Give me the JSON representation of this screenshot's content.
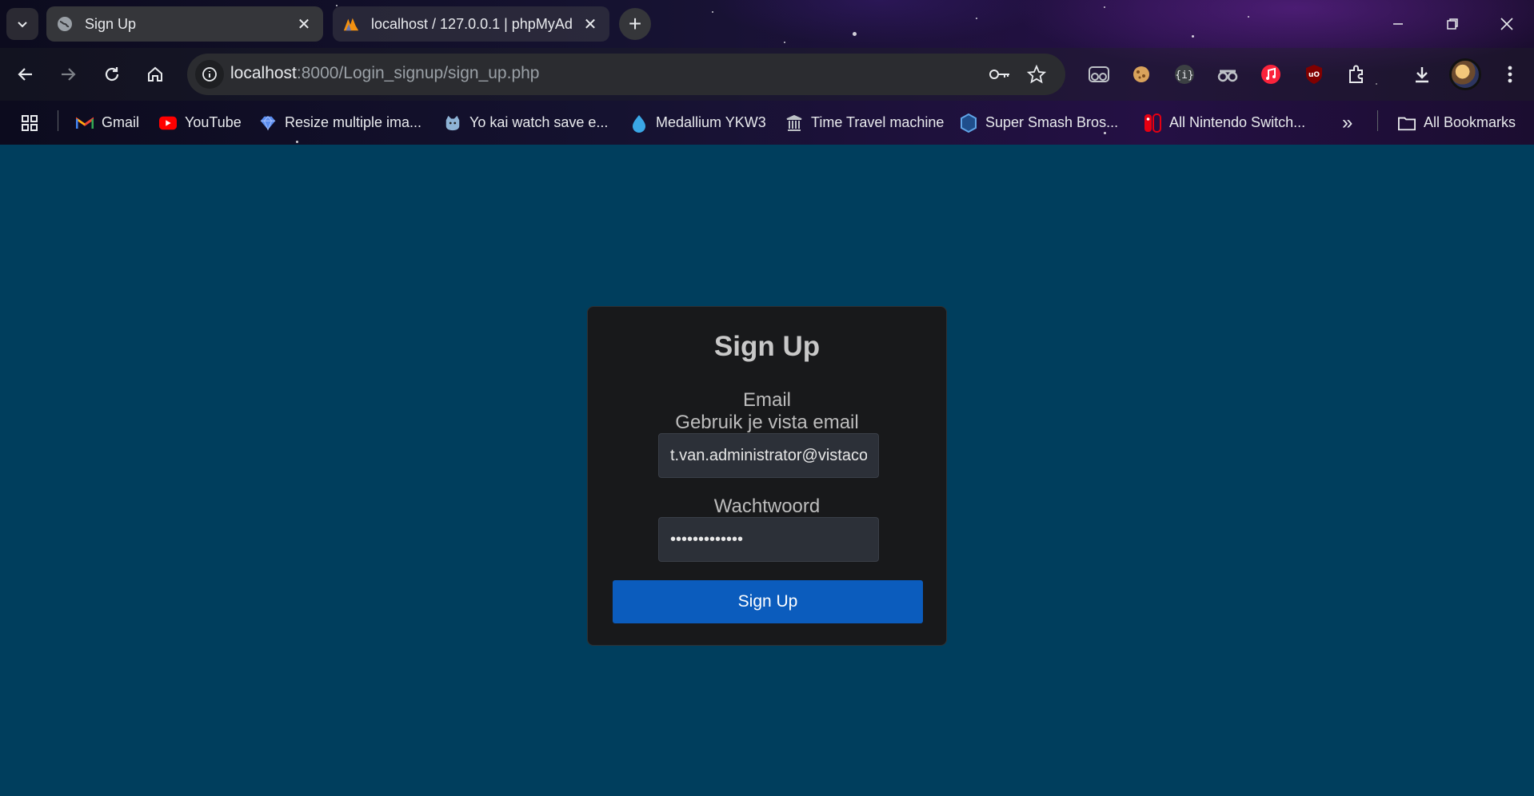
{
  "browser": {
    "tabs": [
      {
        "title": "Sign Up",
        "active": true
      },
      {
        "title": "localhost / 127.0.0.1 | phpMyAd",
        "active": false
      }
    ],
    "address": {
      "host": "localhost",
      "rest": ":8000/Login_signup/sign_up.php"
    },
    "bookmarks": [
      {
        "label": "Gmail",
        "icon": "gmail-icon"
      },
      {
        "label": "YouTube",
        "icon": "youtube-icon"
      },
      {
        "label": "Resize multiple ima...",
        "icon": "diamond-icon"
      },
      {
        "label": "Yo kai watch save e...",
        "icon": "cat-icon"
      },
      {
        "label": "Medallium YKW3",
        "icon": "drop-icon"
      },
      {
        "label": "Time Travel machine",
        "icon": "museum-icon"
      },
      {
        "label": "Super Smash Bros...",
        "icon": "hexagon-icon"
      },
      {
        "label": "All Nintendo Switch...",
        "icon": "switch-icon"
      }
    ],
    "all_bookmarks": "All Bookmarks",
    "more_bookmarks": "»"
  },
  "form": {
    "title": "Sign Up",
    "email_label": "Email",
    "email_hint": "Gebruik je vista email",
    "email_value": "t.van.administrator@vistacollege.nl",
    "password_label": "Wachtwoord",
    "password_value": "administrator",
    "submit_label": "Sign Up"
  },
  "colors": {
    "page_bg": "#003e5d",
    "card_bg": "#18191b",
    "button_bg": "#0b5cbd"
  }
}
